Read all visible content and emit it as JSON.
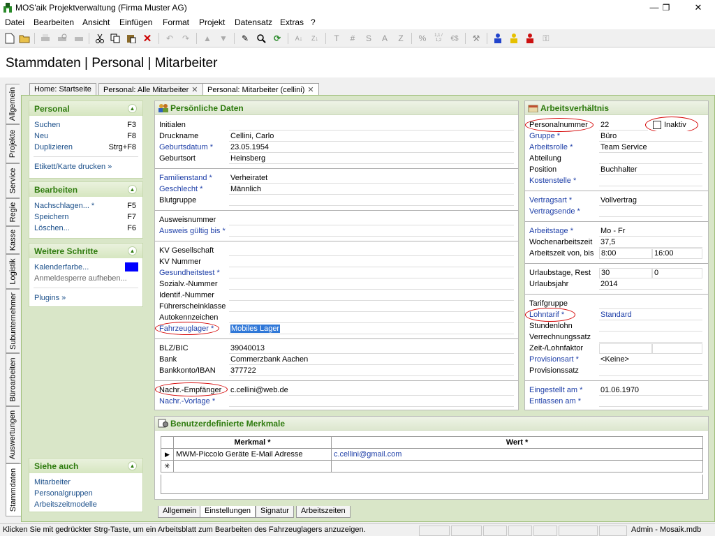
{
  "window": {
    "title": "MOS'aik Projektverwaltung (Firma Muster AG)",
    "minimize": "—",
    "maximize": "❐",
    "close": "✕"
  },
  "menu": [
    "Datei",
    "Bearbeiten",
    "Ansicht",
    "Einfügen",
    "Format",
    "Projekt",
    "Datensatz",
    "Extras",
    "?"
  ],
  "toolbar": {
    "text_buttons": [
      "T",
      "#",
      "S",
      "A",
      "Z",
      "%",
      "1,1 / 1,2",
      "€$"
    ]
  },
  "page_title": "Stammdaten | Personal | Mitarbeiter",
  "doc_tabs": [
    {
      "label": "Home: Startseite"
    },
    {
      "label": "Personal: Alle Mitarbeiter",
      "close": "✕"
    },
    {
      "label": "Personal: Mitarbeiter (cellini)",
      "close": "✕"
    }
  ],
  "side_tabs": [
    "Allgemein",
    "Projekte",
    "Service",
    "Regie",
    "Kasse",
    "Logistik",
    "Subunternehmer",
    "Büroarbeiten",
    "Auswertungen",
    "Stammdaten"
  ],
  "nav": {
    "personal": {
      "title": "Personal",
      "collapse": "▲",
      "items": [
        {
          "label": "Suchen",
          "key": "F3"
        },
        {
          "label": "Neu",
          "key": "F8"
        },
        {
          "label": "Duplizieren",
          "key": "Strg+F8"
        }
      ],
      "extra": "Etikett/Karte drucken »"
    },
    "bearbeiten": {
      "title": "Bearbeiten",
      "collapse": "▲",
      "items": [
        {
          "label": "Nachschlagen... *",
          "key": "F5"
        },
        {
          "label": "Speichern",
          "key": "F7"
        },
        {
          "label": "Löschen...",
          "key": "F6"
        }
      ]
    },
    "weitere": {
      "title": "Weitere Schritte",
      "collapse": "▲",
      "items": [
        "Kalenderfarbe...",
        "Anmeldesperre aufheben..."
      ],
      "calendar_color": "#0000ff",
      "plugins": "Plugins »"
    },
    "siehe": {
      "title": "Siehe auch",
      "collapse": "▲",
      "items": [
        "Mitarbeiter",
        "Personalgruppen",
        "Arbeitszeitmodelle"
      ]
    }
  },
  "personal": {
    "title": "Persönliche Daten",
    "labels": {
      "initialen": "Initialen",
      "druckname": "Druckname",
      "geburtsdatum": "Geburtsdatum *",
      "geburtsort": "Geburtsort",
      "familienstand": "Familienstand *",
      "geschlecht": "Geschlecht *",
      "blutgruppe": "Blutgruppe",
      "ausweisnummer": "Ausweisnummer",
      "ausweis_gueltig": "Ausweis gültig bis *",
      "kv_gesellschaft": "KV Gesellschaft",
      "kv_nummer": "KV Nummer",
      "gesundheitstest": "Gesundheitstest *",
      "sozialv": "Sozialv.-Nummer",
      "identif": "Identif.-Nummer",
      "fuehrerschein": "Führerscheinklasse",
      "autokennzeichen": "Autokennzeichen",
      "fahrzeuglager": "Fahrzeuglager *",
      "blz": "BLZ/BIC",
      "bank": "Bank",
      "konto": "Bankkonto/IBAN",
      "nachr_empf": "Nachr.-Empfänger",
      "nachr_vorlage": "Nachr.-Vorlage *"
    },
    "values": {
      "initialen": "",
      "druckname": "Cellini, Carlo",
      "geburtsdatum": "23.05.1954",
      "geburtsort": "Heinsberg",
      "familienstand": "Verheiratet",
      "geschlecht": "Männlich",
      "blutgruppe": "",
      "ausweisnummer": "",
      "ausweis_gueltig": "",
      "kv_gesellschaft": "",
      "kv_nummer": "",
      "gesundheitstest": "",
      "sozialv": "",
      "identif": "",
      "fuehrerschein": "",
      "autokennzeichen": "",
      "fahrzeuglager": "Mobiles Lager",
      "blz": "39040013",
      "bank": "Commerzbank Aachen",
      "konto": "377722",
      "nachr_empf": "c.cellini@web.de",
      "nachr_vorlage": ""
    }
  },
  "arbeit": {
    "title": "Arbeitsverhältnis",
    "inaktiv_label": "Inaktiv",
    "labels": {
      "personalnummer": "Personalnummer",
      "gruppe": "Gruppe *",
      "arbeitsrolle": "Arbeitsrolle *",
      "abteilung": "Abteilung",
      "position": "Position",
      "kostenstelle": "Kostenstelle *",
      "vertragsart": "Vertragsart *",
      "vertragsende": "Vertragsende *",
      "arbeitstage": "Arbeitstage *",
      "wochenarbeitszeit": "Wochenarbeitszeit",
      "arbeitszeit": "Arbeitszeit von, bis",
      "urlaubstage": "Urlaubstage, Rest",
      "urlaubsjahr": "Urlaubsjahr",
      "tarifgruppe": "Tarifgruppe",
      "lohntarif": "Lohntarif *",
      "stundenlohn": "Stundenlohn",
      "verrechnungssatz": "Verrechnungssatz",
      "zeitlohnfaktor": "Zeit-/Lohnfaktor",
      "provisionsart": "Provisionsart *",
      "provisionssatz": "Provisionssatz",
      "eingestellt": "Eingestellt am *",
      "entlassen": "Entlassen am *"
    },
    "values": {
      "personalnummer": "22",
      "gruppe": "Büro",
      "arbeitsrolle": "Team Service",
      "abteilung": "",
      "position": "Buchhalter",
      "kostenstelle": "",
      "vertragsart": "Vollvertrag",
      "vertragsende": "",
      "arbeitstage": "Mo - Fr",
      "wochenarbeitszeit": "37,5",
      "arbeitszeit_von": "8:00",
      "arbeitszeit_bis": "16:00",
      "urlaubstage": "30",
      "urlaubsrest": "0",
      "urlaubsjahr": "2014",
      "tarifgruppe": "",
      "lohntarif": "Standard",
      "stundenlohn": "",
      "verrechnungssatz": "",
      "zeitlohnfaktor": "",
      "zeitlohnfaktor2": "",
      "provisionsart": "<Keine>",
      "provisionssatz": "",
      "eingestellt": "01.06.1970",
      "entlassen": ""
    }
  },
  "merkmale": {
    "title": "Benutzerdefinierte Merkmale",
    "columns": [
      "Merkmal *",
      "Wert *"
    ],
    "rows": [
      {
        "marker": "▶",
        "merkmal": "MWM-Piccolo Geräte E-Mail Adresse",
        "wert": "c.cellini@gmail.com"
      },
      {
        "marker": "✳",
        "merkmal": "",
        "wert": ""
      }
    ]
  },
  "bottom_tabs": [
    "Allgemein",
    "Einstellungen",
    "Signatur",
    "Arbeitszeiten"
  ],
  "status": {
    "text": "Klicken Sie mit gedrückter Strg-Taste, um ein Arbeitsblatt zum Bearbeiten des Fahrzeuglagers anzuzeigen.",
    "user": "Admin - Mosaik.mdb"
  }
}
